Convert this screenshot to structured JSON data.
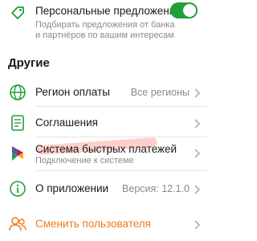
{
  "offers": {
    "title": "Персональные предложения",
    "subtitle_line1": "Подбирать предложения от банка",
    "subtitle_line2": "и партнёров по вашим интересам",
    "toggle_on": true,
    "icon": "tag-icon"
  },
  "section": {
    "title": "Другие"
  },
  "items": [
    {
      "title": "Регион оплаты",
      "value": "Все регионы",
      "icon": "globe-icon"
    },
    {
      "title": "Соглашения",
      "icon": "document-icon"
    },
    {
      "title": "Система быстрых платежей",
      "subtitle": "Подключение к системе",
      "icon": "sbp-logo-icon"
    },
    {
      "title": "О приложении",
      "value": "Версия: 12.1.0",
      "icon": "info-icon"
    },
    {
      "title": "Сменить пользователя",
      "icon": "users-icon"
    }
  ],
  "colors": {
    "accent_green": "#21a038",
    "accent_orange": "#f07a1a",
    "secondary_text": "#8a8a8a",
    "highlight": "#ff968c"
  }
}
